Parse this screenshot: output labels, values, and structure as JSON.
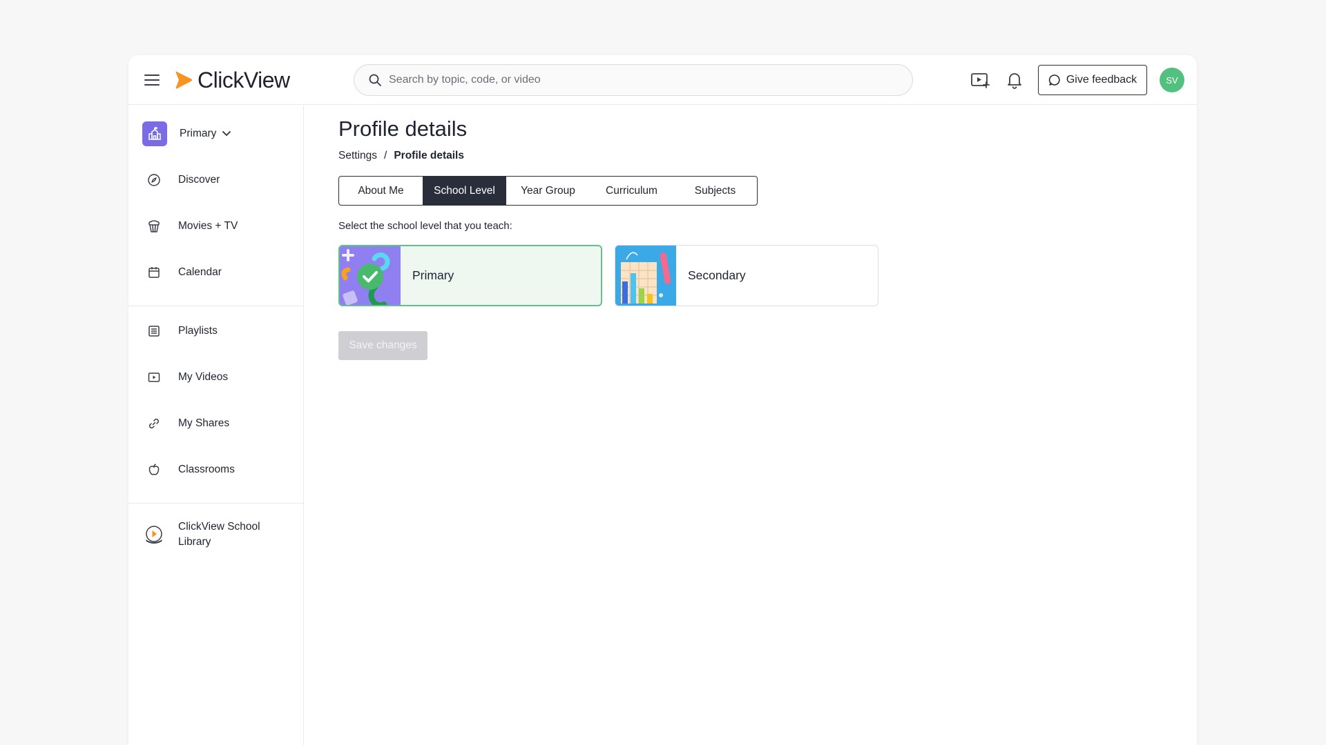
{
  "header": {
    "brand": "ClickView",
    "search_placeholder": "Search by topic, code, or video",
    "feedback_label": "Give feedback",
    "avatar_initials": "SV",
    "brand_color": "#f7931e"
  },
  "sidebar": {
    "level_selector": "Primary",
    "items": [
      {
        "label": "Discover",
        "icon": "compass-icon"
      },
      {
        "label": "Movies + TV",
        "icon": "popcorn-icon"
      },
      {
        "label": "Calendar",
        "icon": "calendar-icon"
      },
      {
        "label": "Playlists",
        "icon": "list-icon"
      },
      {
        "label": "My Videos",
        "icon": "video-icon"
      },
      {
        "label": "My Shares",
        "icon": "link-icon"
      },
      {
        "label": "Classrooms",
        "icon": "apple-icon"
      }
    ],
    "library_line1": "ClickView School",
    "library_line2": "Library"
  },
  "main": {
    "title": "Profile details",
    "breadcrumb": {
      "parent": "Settings",
      "separator": "/",
      "current": "Profile details"
    },
    "tabs": [
      {
        "label": "About Me",
        "active": false
      },
      {
        "label": "School Level",
        "active": true
      },
      {
        "label": "Year Group",
        "active": false
      },
      {
        "label": "Curriculum",
        "active": false
      },
      {
        "label": "Subjects",
        "active": false
      }
    ],
    "prompt": "Select the school level that you teach:",
    "options": [
      {
        "label": "Primary",
        "selected": true
      },
      {
        "label": "Secondary",
        "selected": false
      }
    ],
    "save_label": "Save changes"
  }
}
